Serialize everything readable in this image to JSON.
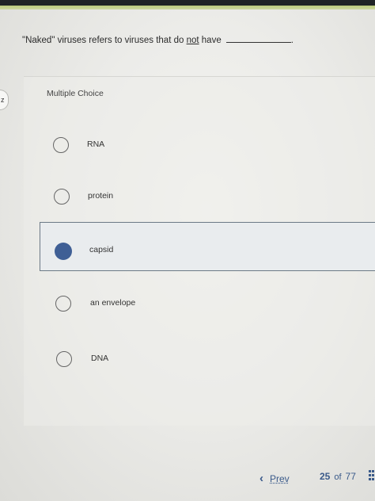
{
  "question": {
    "text_before": "\"Naked\" viruses refers to viruses that do ",
    "emphasis": "not",
    "text_after": " have",
    "end_punct": "."
  },
  "question_type": "Multiple Choice",
  "left_tab_text": "z",
  "options": [
    {
      "label": "RNA",
      "selected": false
    },
    {
      "label": "protein",
      "selected": false
    },
    {
      "label": "capsid",
      "selected": true
    },
    {
      "label": "an envelope",
      "selected": false
    },
    {
      "label": "DNA",
      "selected": false
    }
  ],
  "footer": {
    "prev_label": "Prev",
    "prev_icon": "chevron-left-icon",
    "current_page": "25",
    "of_label": "of",
    "total_pages": "77",
    "grid_icon": "grid-icon"
  },
  "colors": {
    "selected_radio": "#3f5f95",
    "link": "#3a5a8a",
    "top_bar": "#1f2326",
    "accent_strip": "#b9c979"
  }
}
